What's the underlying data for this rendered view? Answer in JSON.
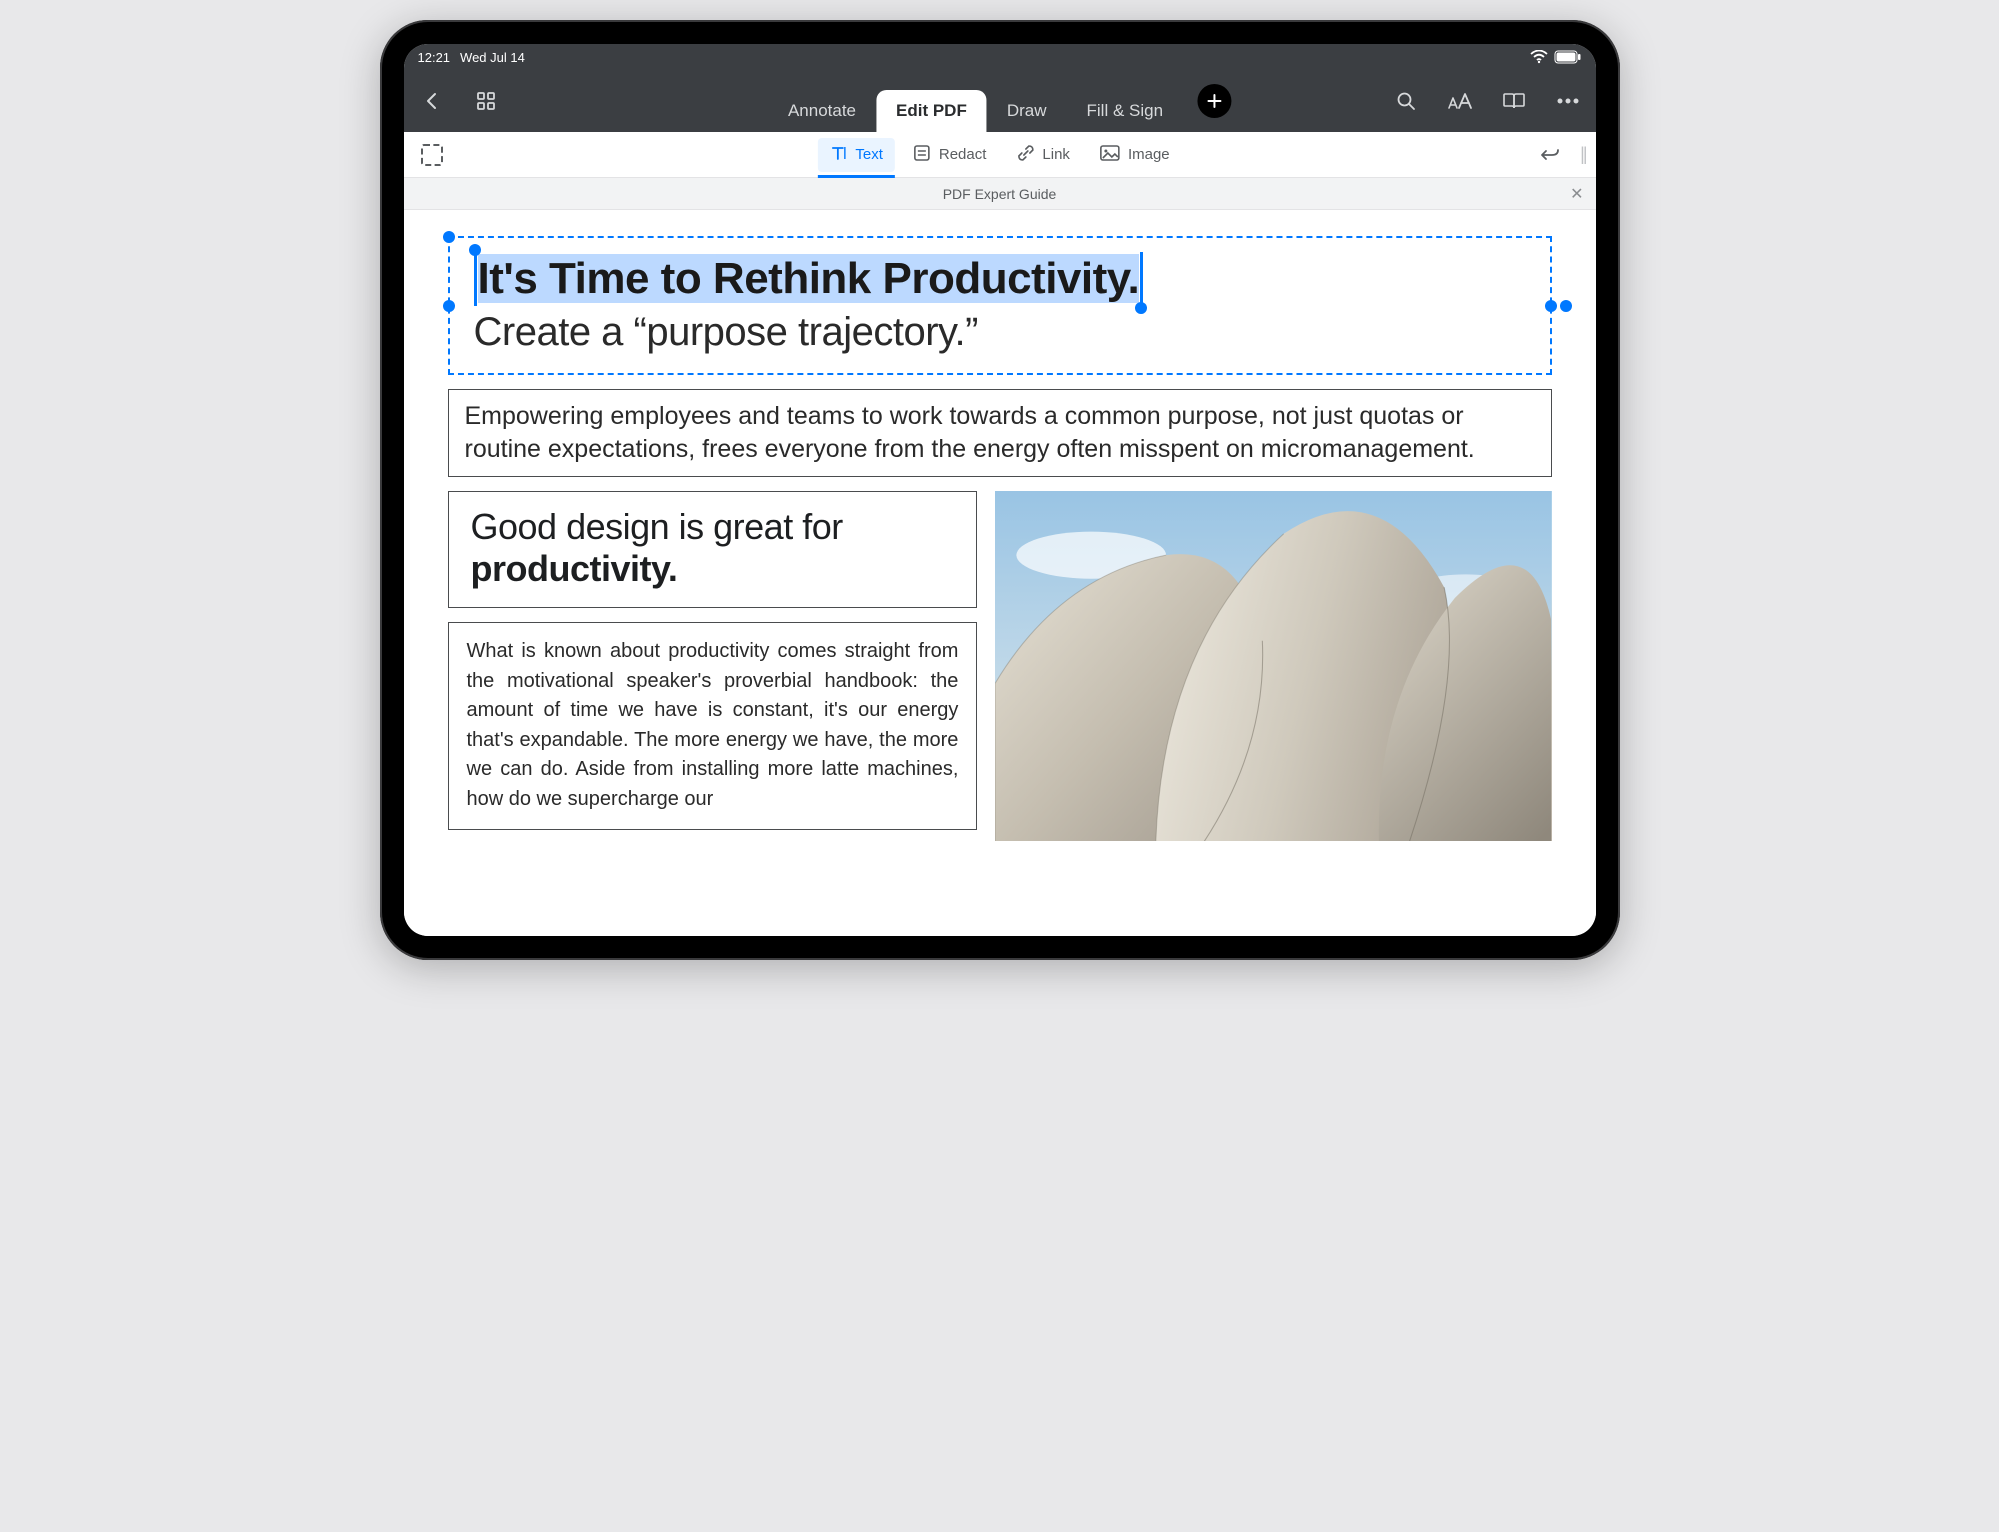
{
  "status": {
    "time": "12:21",
    "date": "Wed Jul 14"
  },
  "tabs": {
    "annotate": "Annotate",
    "editpdf": "Edit PDF",
    "draw": "Draw",
    "fillsign": "Fill & Sign"
  },
  "subtools": {
    "text": "Text",
    "redact": "Redact",
    "link": "Link",
    "image": "Image"
  },
  "doc_title": "PDF Expert Guide",
  "content": {
    "headline": "It's Time to Rethink Productivity.",
    "subhead": "Create a “purpose trajectory.”",
    "intro": "Empowering employees and teams to work towards a common purpose, not just quotas or routine expectations, frees everyone from the energy often misspent on micromanagement.",
    "h2_pre": "Good design is great for ",
    "h2_bold": "productivity.",
    "body": "What is known about productivity comes straight from the motivational speaker's proverbial handbook: the amount of time we have is constant, it's our energy that's expandable. The more energy we have, the more we can do. Aside from installing more latte machines, how do we supercharge our"
  }
}
